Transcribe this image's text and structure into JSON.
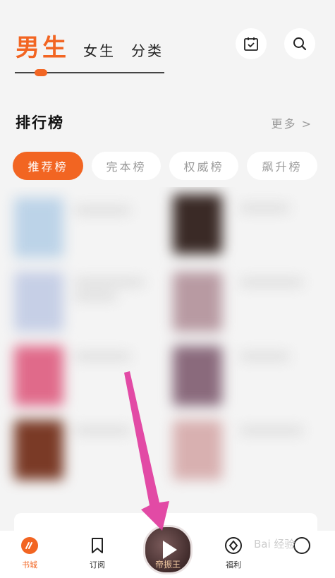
{
  "header": {
    "tabs": [
      "男生",
      "女生",
      "分类"
    ],
    "active_tab": "男生"
  },
  "ranking": {
    "title": "排行榜",
    "more": "更多 >",
    "chips": [
      "推荐榜",
      "完本榜",
      "权威榜",
      "飙升榜"
    ],
    "active_chip": "推荐榜"
  },
  "bottom_nav": {
    "items": [
      {
        "label": "书城",
        "icon": "bookstore-icon"
      },
      {
        "label": "订阅",
        "icon": "bookmark-icon"
      },
      {
        "label": "福利",
        "icon": "gift-icon"
      }
    ],
    "fab_text": "帝振王"
  },
  "colors": {
    "accent": "#f26522",
    "annotation": "#e040a0"
  },
  "watermark": "Bai 经验"
}
